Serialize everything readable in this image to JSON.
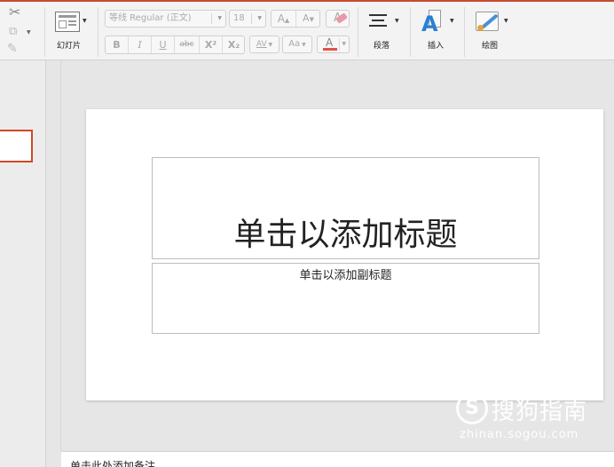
{
  "ribbon": {
    "slide_label": "幻灯片",
    "font_name": "等线 Regular (正文)",
    "font_size": "18",
    "grow_font": "A",
    "shrink_font": "A",
    "bold": "B",
    "italic": "I",
    "underline": "U",
    "strike": "abc",
    "superscript": "X²",
    "subscript": "X₂",
    "char_spacing": "AV",
    "change_case": "Aa",
    "font_color": "A",
    "paragraph_label": "段落",
    "insert_label": "插入",
    "draw_label": "绘图"
  },
  "slide": {
    "title_placeholder": "单击以添加标题",
    "subtitle_placeholder": "单击以添加副标题"
  },
  "notes": {
    "placeholder": "单击此处添加备注"
  },
  "watermark": {
    "logo": "S",
    "name": "搜狗指南",
    "url": "zhinan.sogou.com"
  },
  "colors": {
    "accent": "#d24726",
    "font_color_bar": "#e0524a",
    "insert_icon": "#2a7fd4"
  }
}
